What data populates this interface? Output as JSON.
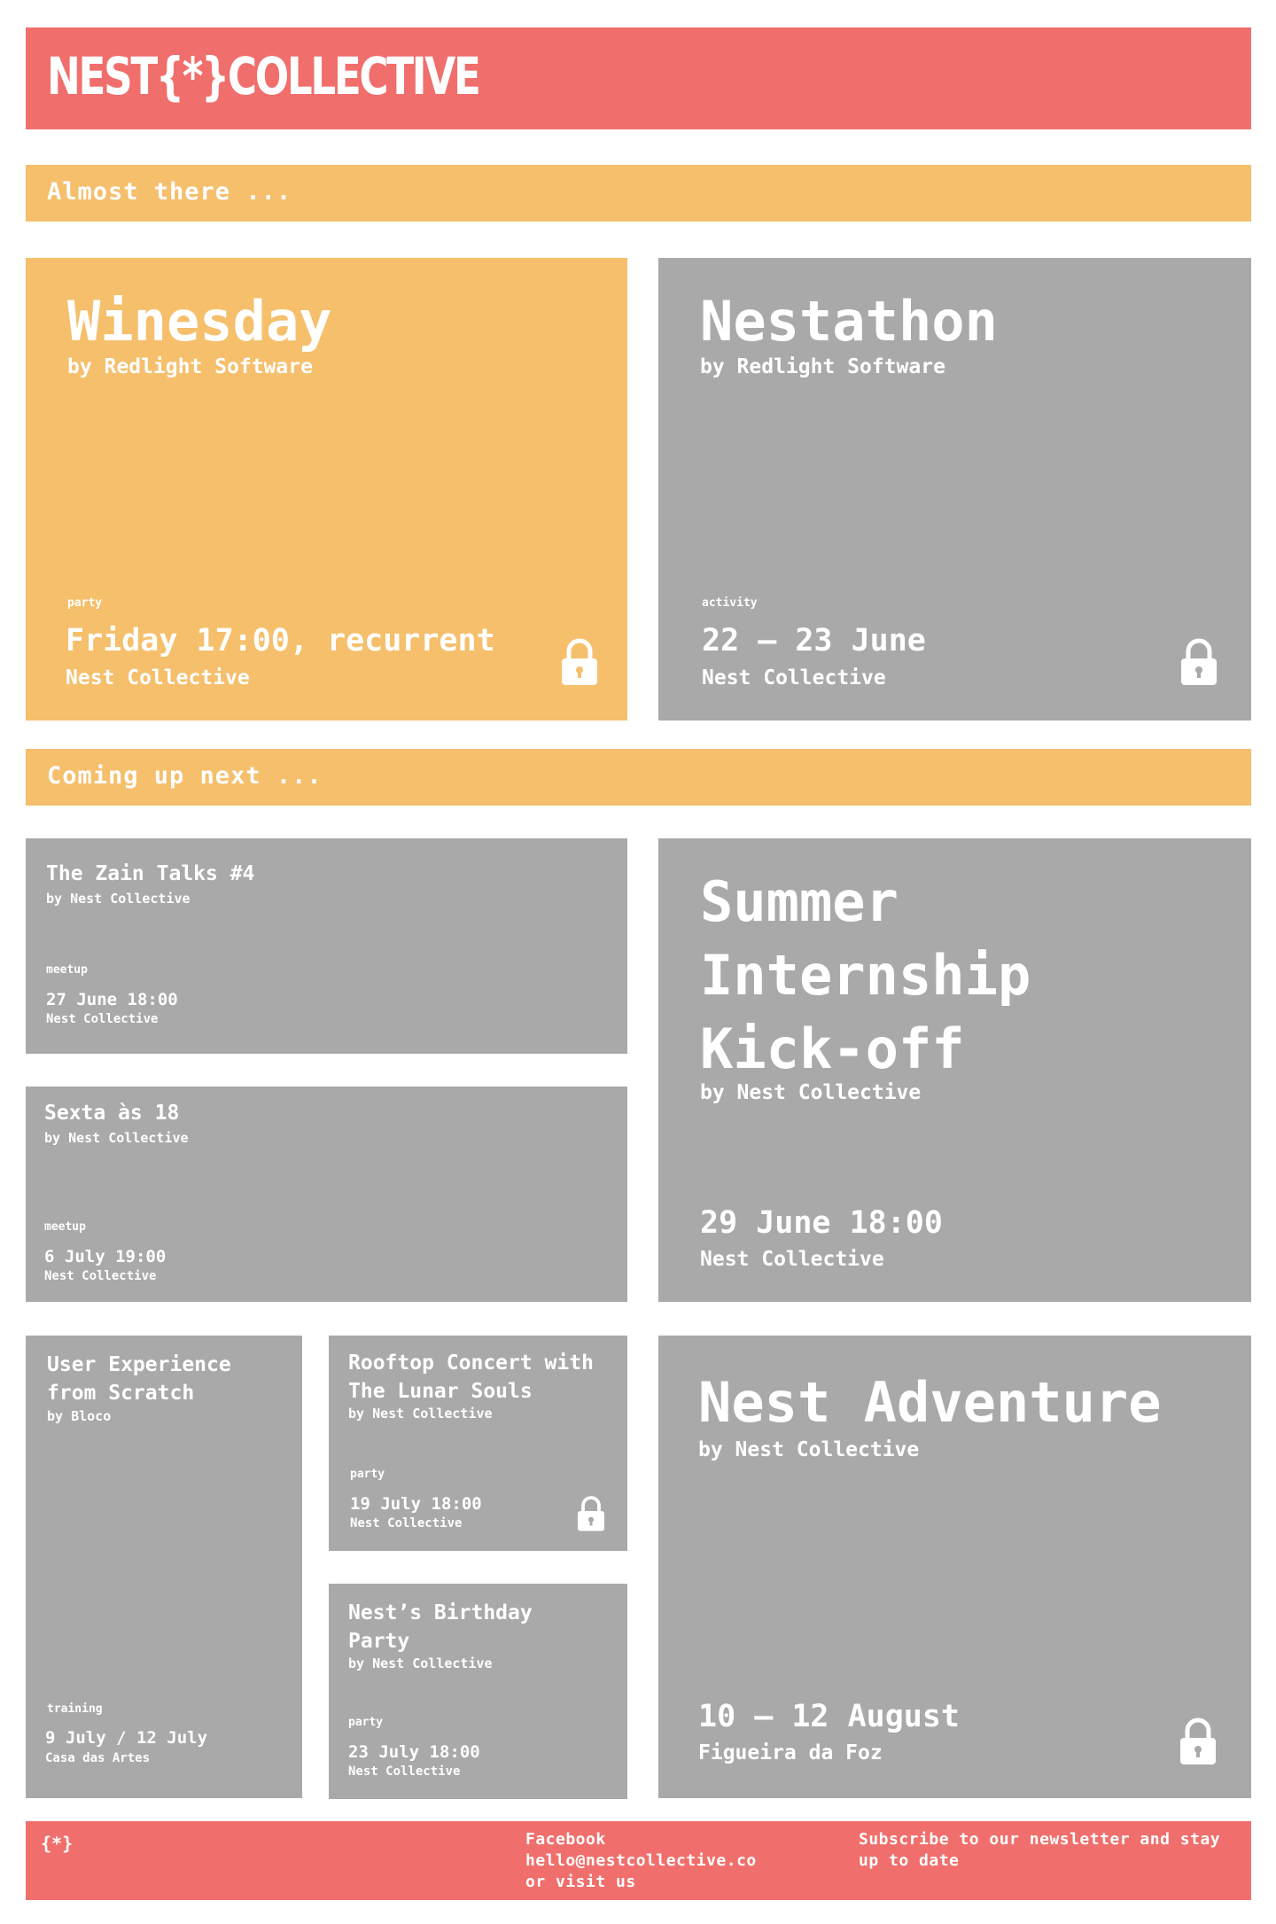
{
  "header": {
    "logo_text": "NEST{*}COLLECTIVE"
  },
  "sections": {
    "almost": "Almost there ...",
    "coming": "Coming up next ..."
  },
  "events": {
    "winesday": {
      "title": "Winesday",
      "by": "by Redlight Software",
      "tag": "party",
      "date": "Friday 17:00, recurrent",
      "venue": "Nest Collective"
    },
    "nestathon": {
      "title": "Nestathon",
      "by": "by Redlight Software",
      "tag": "activity",
      "date": "22 – 23 June",
      "venue": "Nest Collective"
    },
    "zain": {
      "title": "The Zain Talks #4",
      "by": "by Nest Collective",
      "tag": "meetup",
      "date": "27 June 18:00",
      "venue": "Nest Collective"
    },
    "sexta": {
      "title": "Sexta às 18",
      "by": "by Nest Collective",
      "tag": "meetup",
      "date": "6 July 19:00",
      "venue": "Nest Collective"
    },
    "summer": {
      "title": "Summer Internship Kick-off",
      "by": "by Nest Collective",
      "date": "29 June 18:00",
      "venue": "Nest Collective"
    },
    "ux": {
      "title": "User Experience from Scratch",
      "by": "by Bloco",
      "tag": "training",
      "date": "9 July / 12 July",
      "venue": "Casa das Artes"
    },
    "rooftop": {
      "title": "Rooftop Concert with The Lunar Souls",
      "by": "by Nest Collective",
      "tag": "party",
      "date": "19 July 18:00",
      "venue": "Nest Collective"
    },
    "birthday": {
      "title": "Nest’s Birthday Party",
      "by": "by Nest Collective",
      "tag": "party",
      "date": "23 July 18:00",
      "venue": "Nest Collective"
    },
    "adventure": {
      "title": "Nest Adventure",
      "by": "by Nest Collective",
      "date": "10 – 12 August",
      "venue": "Figueira da Foz"
    }
  },
  "footer": {
    "logo": "{*}",
    "facebook": "Facebook",
    "email": "hello@nestcollective.co",
    "visit": "or visit us",
    "subscribe": "Subscribe to our newsletter and stay up to date"
  },
  "colors": {
    "accent_red": "#f06f6c",
    "accent_yellow": "#f5bf6c",
    "card_gray": "#a9a9a9"
  },
  "icons": [
    "lock-icon"
  ]
}
